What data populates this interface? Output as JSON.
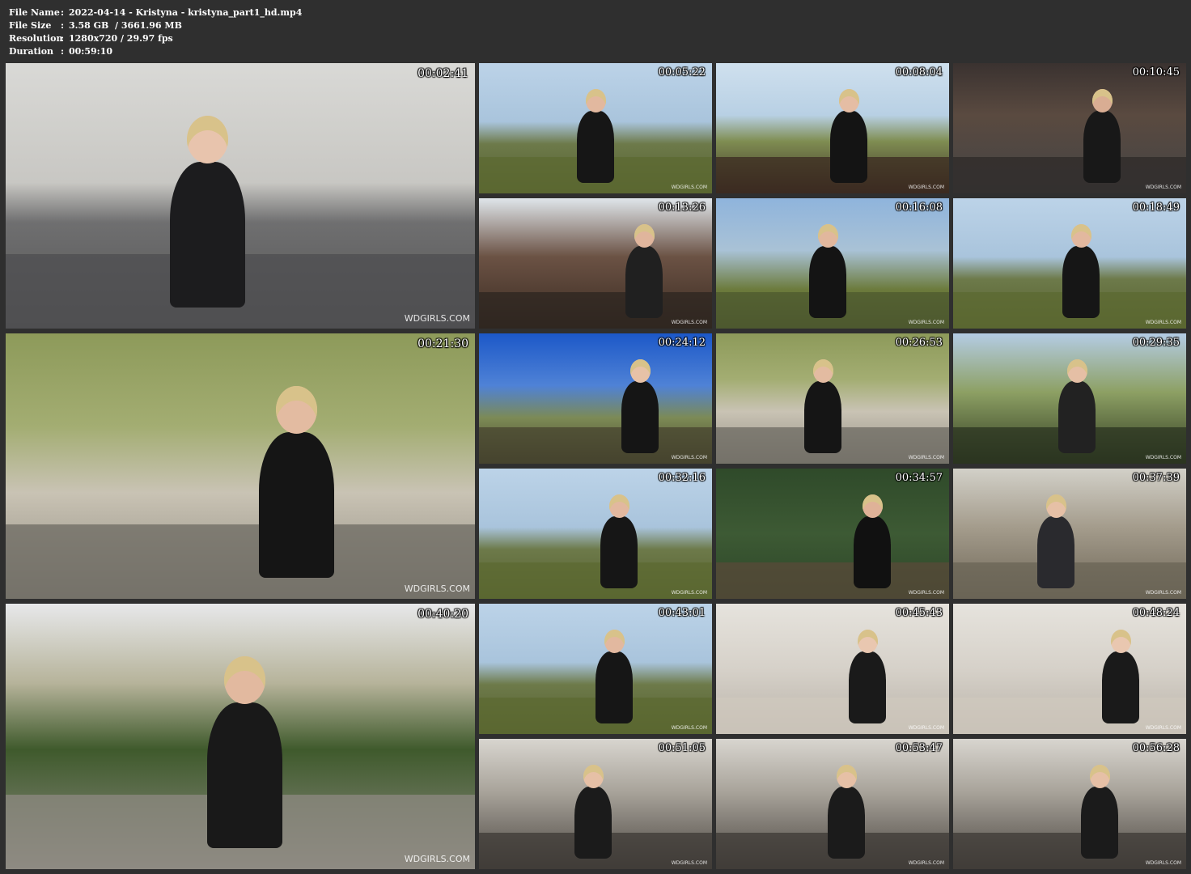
{
  "file_info": {
    "rows": [
      {
        "label": "File Name",
        "value": "2022-04-14 - Kristyna - kristyna_part1_hd.mp4"
      },
      {
        "label": "File Size",
        "value": "3.58 GB  / 3661.96 MB"
      },
      {
        "label": "Resolution",
        "value": "1280x720 / 29.97 fps"
      },
      {
        "label": "Duration",
        "value": "00:59:10"
      }
    ]
  },
  "thumbnails": [
    {
      "time": "00:02:41",
      "watermark": "WDGIRLS.COM",
      "scene": "indoor-sofa"
    },
    {
      "time": "00:05:22",
      "watermark": "WDGIRLS.COM",
      "scene": "park"
    },
    {
      "time": "00:08:04",
      "watermark": "WDGIRLS.COM",
      "scene": "park-bench"
    },
    {
      "time": "00:10:45",
      "watermark": "WDGIRLS.COM",
      "scene": "bench-table"
    },
    {
      "time": "00:13:26",
      "watermark": "WDGIRLS.COM",
      "scene": "bench-closeup"
    },
    {
      "time": "00:16:08",
      "watermark": "WDGIRLS.COM",
      "scene": "tree"
    },
    {
      "time": "00:18:49",
      "watermark": "WDGIRLS.COM",
      "scene": "park"
    },
    {
      "time": "00:21:30",
      "watermark": "WDGIRLS.COM",
      "scene": "stone-sphere"
    },
    {
      "time": "00:24:12",
      "watermark": "WDGIRLS.COM",
      "scene": "park-sitting"
    },
    {
      "time": "00:26:53",
      "watermark": "WDGIRLS.COM",
      "scene": "stone-sphere"
    },
    {
      "time": "00:29:35",
      "watermark": "WDGIRLS.COM",
      "scene": "closeup"
    },
    {
      "time": "00:32:16",
      "watermark": "WDGIRLS.COM",
      "scene": "park"
    },
    {
      "time": "00:34:57",
      "watermark": "WDGIRLS.COM",
      "scene": "ivy"
    },
    {
      "time": "00:37:39",
      "watermark": "WDGIRLS.COM",
      "scene": "walk"
    },
    {
      "time": "00:40:20",
      "watermark": "WDGIRLS.COM",
      "scene": "path"
    },
    {
      "time": "00:43:01",
      "watermark": "WDGIRLS.COM",
      "scene": "park"
    },
    {
      "time": "00:45:43",
      "watermark": "WDGIRLS.COM",
      "scene": "bathroom"
    },
    {
      "time": "00:48:24",
      "watermark": "WDGIRLS.COM",
      "scene": "bathroom"
    },
    {
      "time": "00:51:05",
      "watermark": "WDGIRLS.COM",
      "scene": "indoor-room"
    },
    {
      "time": "00:53:47",
      "watermark": "WDGIRLS.COM",
      "scene": "indoor-room"
    },
    {
      "time": "00:56:28",
      "watermark": "WDGIRLS.COM",
      "scene": "indoor-room"
    }
  ]
}
